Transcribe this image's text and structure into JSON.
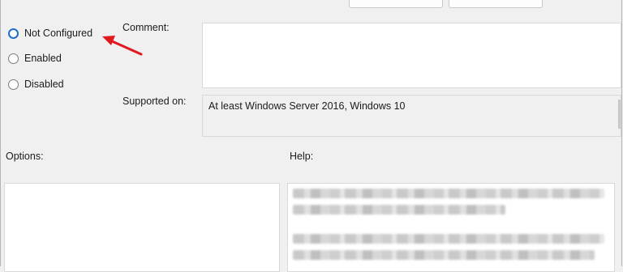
{
  "state": {
    "options": [
      {
        "label": "Not Configured",
        "selected": true
      },
      {
        "label": "Enabled",
        "selected": false
      },
      {
        "label": "Disabled",
        "selected": false
      }
    ]
  },
  "comment": {
    "label": "Comment:",
    "value": ""
  },
  "supported_on": {
    "label": "Supported on:",
    "value": "At least Windows Server 2016, Windows 10"
  },
  "options_pane": {
    "label": "Options:"
  },
  "help_pane": {
    "label": "Help:"
  },
  "annotation": {
    "arrow_color": "#e0191e"
  },
  "colors": {
    "radio_selected": "#1f6fc9",
    "background": "#f0f0f0"
  }
}
